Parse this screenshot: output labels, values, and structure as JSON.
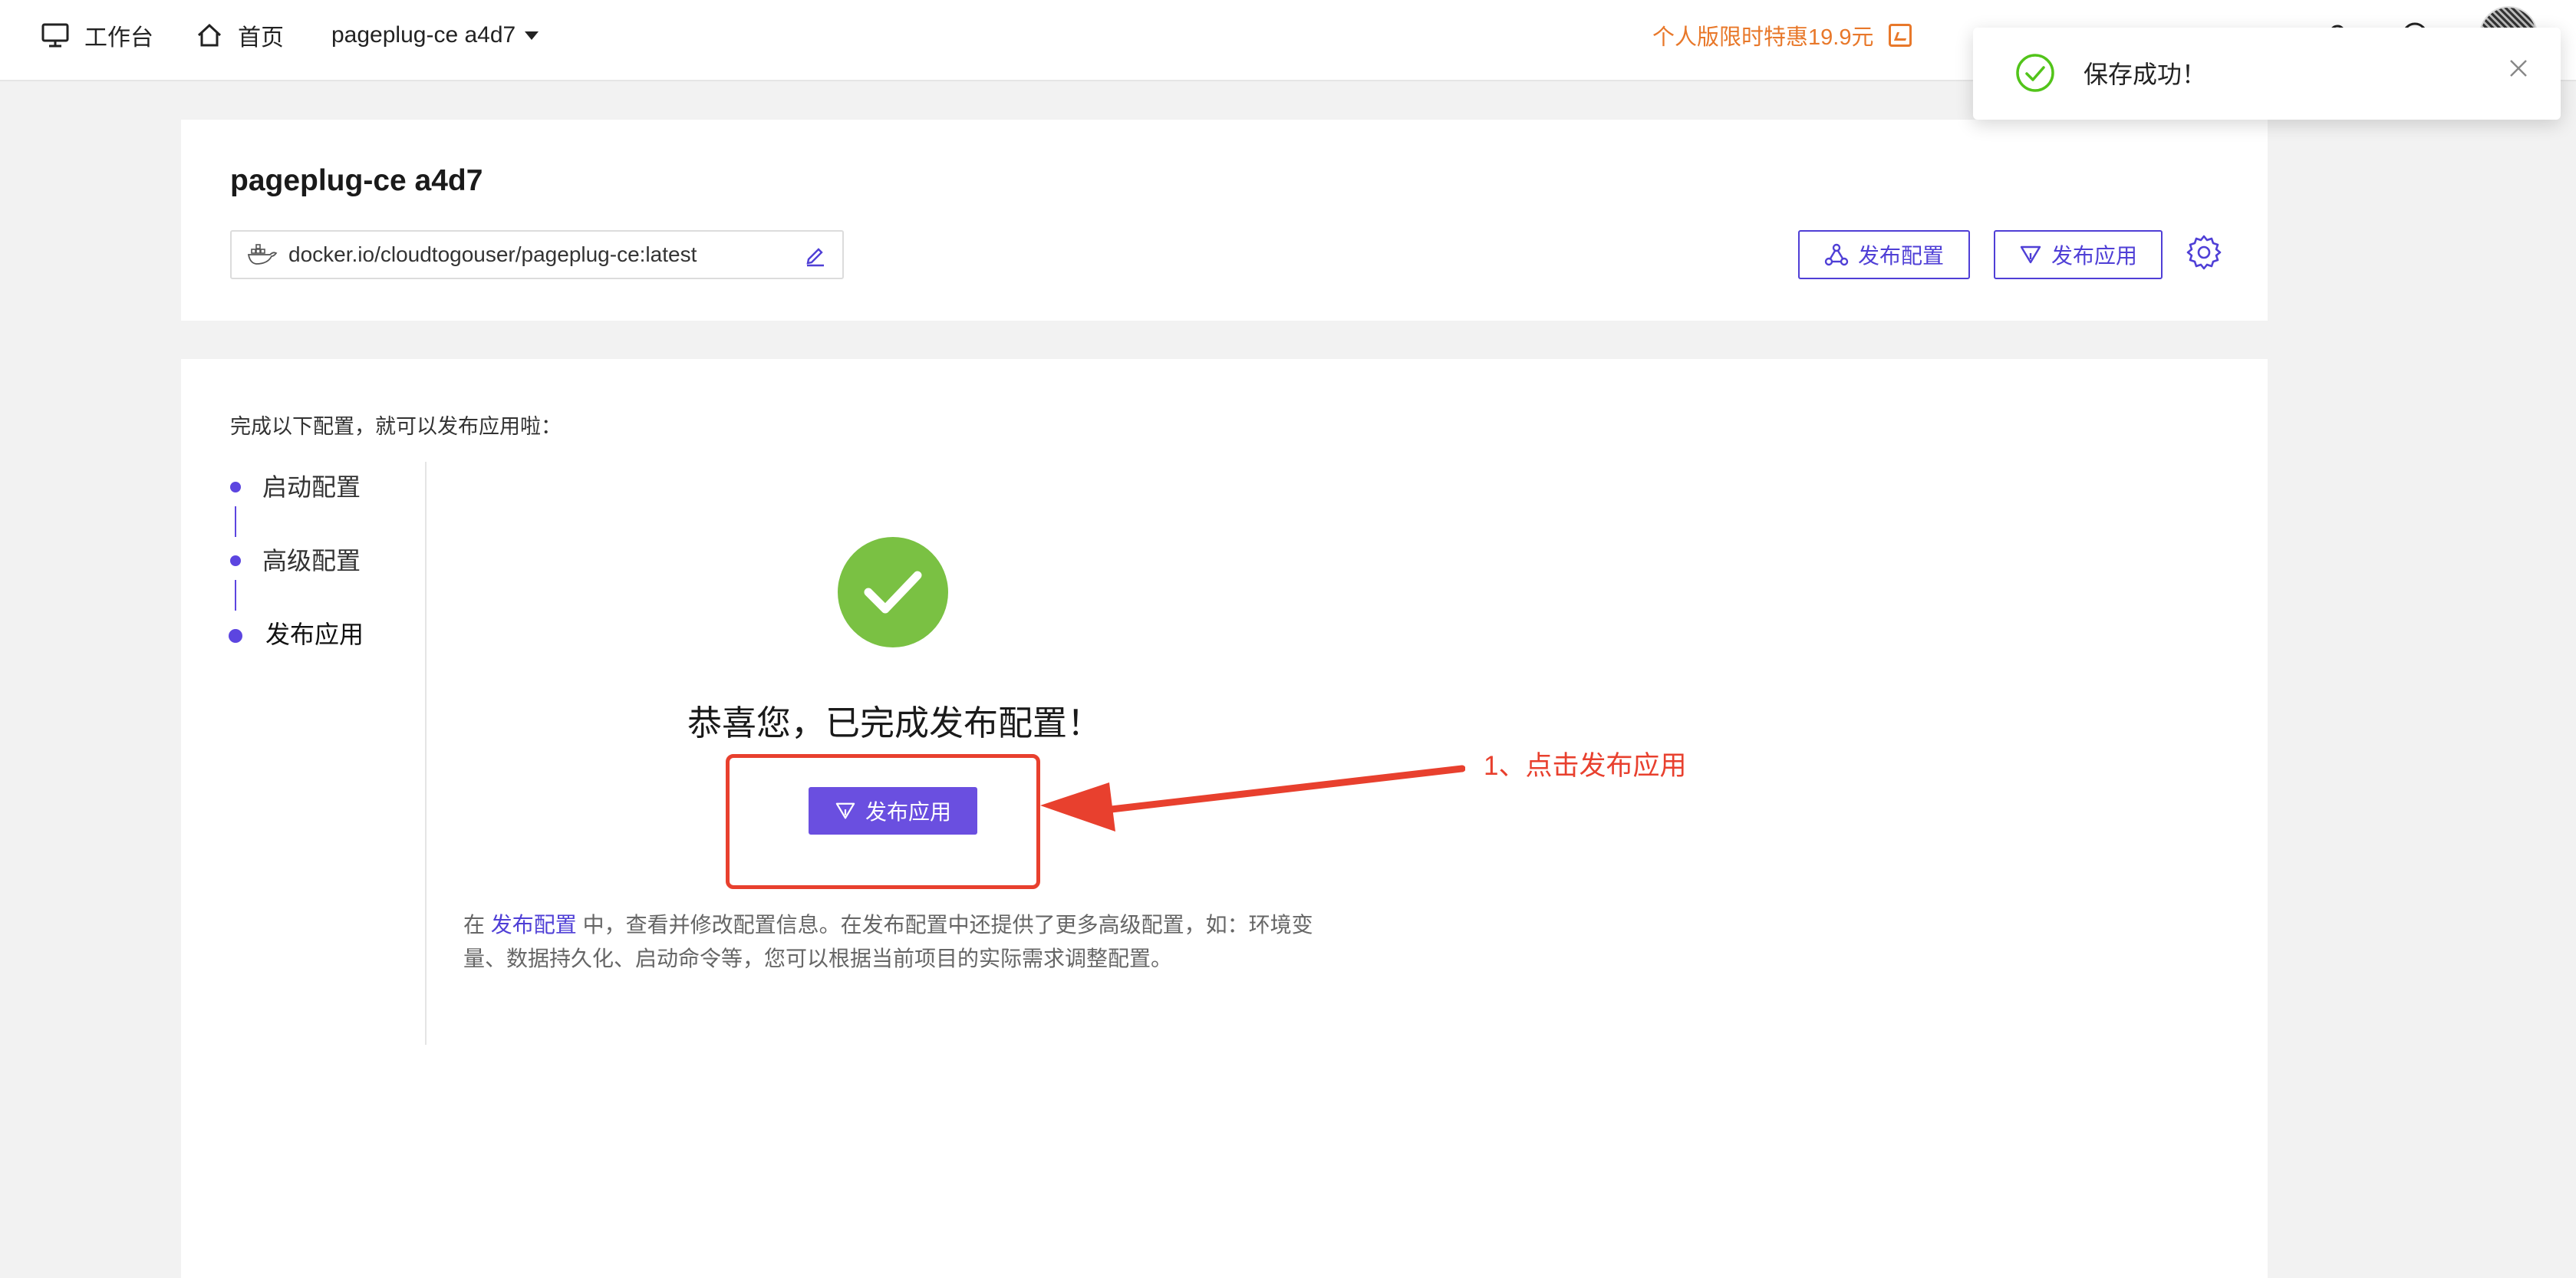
{
  "topbar": {
    "workbench_label": "工作台",
    "home_label": "首页",
    "app_name": "pageplug-ce a4d7",
    "promo_text": "个人版限时特惠19.9元",
    "link1": "",
    "link2": ""
  },
  "header": {
    "title": "pageplug-ce a4d7",
    "image": "docker.io/cloudtogouser/pageplug-ce:latest",
    "config_button": "发布配置",
    "publish_button": "发布应用"
  },
  "main": {
    "intro": "完成以下配置，就可以发布应用啦：",
    "steps": [
      {
        "label": "启动配置"
      },
      {
        "label": "高级配置"
      },
      {
        "label": "发布应用"
      }
    ],
    "congrats": "恭喜您，已完成发布配置！",
    "publish_button": "发布应用",
    "hint_prefix": "在 ",
    "hint_link": "发布配置",
    "hint_line1_rest": " 中，查看并修改配置信息。在发布配置中还提供了更多高级配置，如：环境变",
    "hint_line2": "量、数据持久化、启动命令等，您可以根据当前项目的实际需求调整配置。"
  },
  "annotation": {
    "text": "1、点击发布应用",
    "color": "#e8402e"
  },
  "toast": {
    "message": "保存成功！"
  },
  "colors": {
    "accent": "#4f3fd6",
    "button_fill": "#6a4fe0",
    "success": "#7ac143",
    "promo": "#e8782a"
  }
}
